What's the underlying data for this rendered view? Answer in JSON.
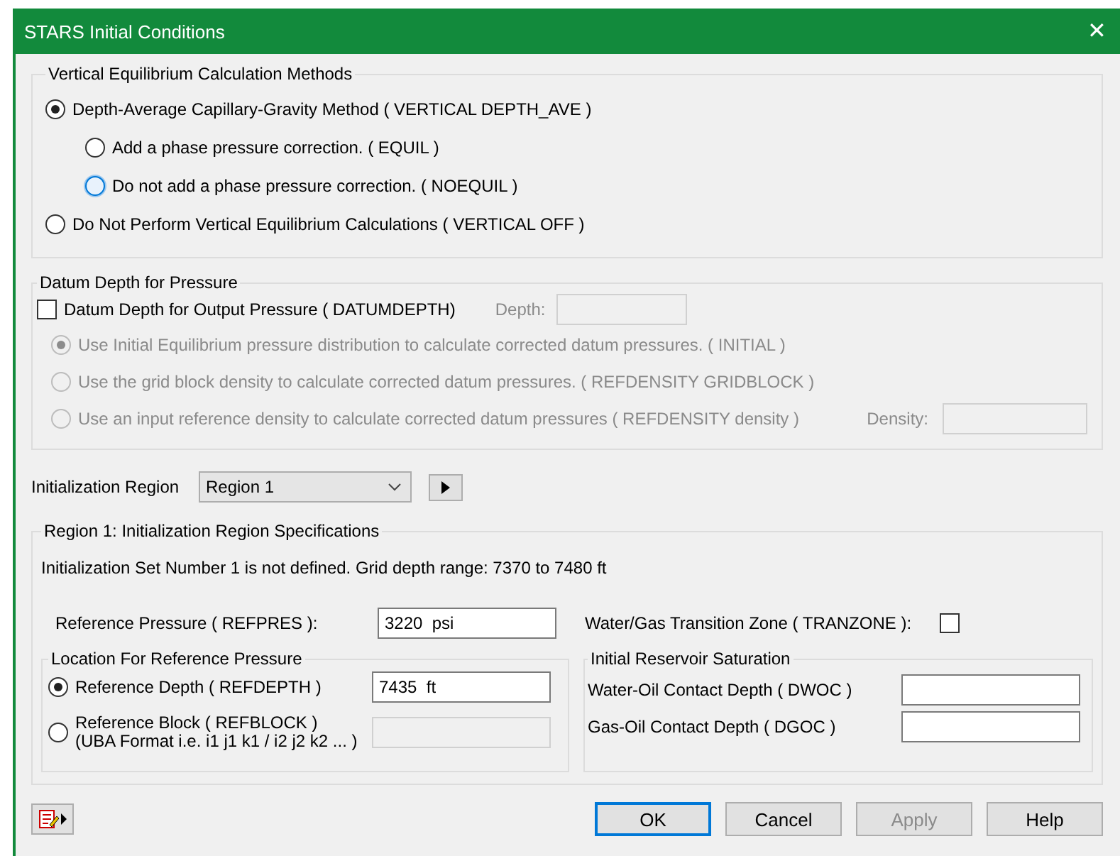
{
  "window": {
    "title": "STARS Initial Conditions",
    "close": "✕"
  },
  "vertical_equilibrium": {
    "legend": "Vertical Equilibrium Calculation Methods",
    "options": [
      {
        "label": "Depth-Average Capillary-Gravity Method ( VERTICAL DEPTH_AVE )",
        "selected": true,
        "children": [
          {
            "label": "Add a phase pressure correction. ( EQUIL )",
            "selected": false,
            "focused": false
          },
          {
            "label": "Do not add a phase pressure correction. ( NOEQUIL )",
            "selected": false,
            "focused": true
          }
        ]
      },
      {
        "label": "Do Not Perform Vertical Equilibrium Calculations ( VERTICAL OFF )",
        "selected": false
      }
    ]
  },
  "datum": {
    "legend": "Datum Depth for Pressure",
    "checkbox": {
      "label": "Datum Depth for Output Pressure ( DATUMDEPTH)",
      "checked": false
    },
    "depth_label": "Depth:",
    "disabled": true,
    "options": [
      {
        "label": "Use Initial Equilibrium pressure distribution to calculate corrected datum pressures. ( INITIAL )",
        "selected": true
      },
      {
        "label": "Use the grid block density to calculate corrected datum pressures. ( REFDENSITY GRIDBLOCK )",
        "selected": false
      },
      {
        "label": "Use an input reference density to calculate corrected datum pressures ( REFDENSITY density )",
        "selected": false
      }
    ],
    "density_label": "Density:"
  },
  "region": {
    "label": "Initialization Region",
    "value": "Region 1"
  },
  "spec": {
    "legend": "Region 1: Initialization Region Specifications",
    "info": "Initialization Set Number 1 is not defined. Grid depth range: 7370 to 7480 ft",
    "ref_pressure": {
      "label": "Reference Pressure ( REFPRES ):",
      "value": "3220  psi"
    },
    "tranzone": {
      "label": "Water/Gas Transition Zone ( TRANZONE ):",
      "checked": false
    },
    "location": {
      "legend": "Location For Reference Pressure",
      "options": [
        {
          "label": "Reference Depth ( REFDEPTH )",
          "selected": true,
          "value": "7435  ft",
          "disabled": false
        },
        {
          "label": "Reference Block ( REFBLOCK )",
          "sublabel": "(UBA Format i.e. i1 j1 k1 / i2 j2 k2 ... )",
          "selected": false,
          "disabled": true
        }
      ]
    },
    "saturation": {
      "legend": "Initial Reservoir Saturation",
      "fields": [
        {
          "label": "Water-Oil Contact Depth ( DWOC )"
        },
        {
          "label": "Gas-Oil Contact Depth ( DGOC )"
        }
      ]
    }
  },
  "buttons": [
    {
      "label": "OK",
      "default": true,
      "disabled": false
    },
    {
      "label": "Cancel",
      "default": false,
      "disabled": false
    },
    {
      "label": "Apply",
      "default": false,
      "disabled": true
    },
    {
      "label": "Help",
      "default": false,
      "disabled": false
    }
  ]
}
